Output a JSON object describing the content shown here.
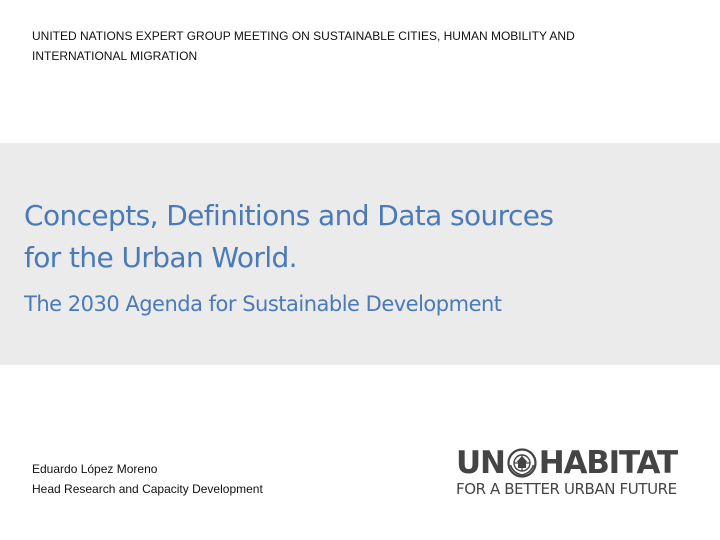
{
  "header": {
    "meeting": "UNITED NATIONS EXPERT GROUP MEETING ON SUSTAINABLE CITIES, HUMAN MOBILITY AND INTERNATIONAL MIGRATION"
  },
  "title": {
    "line1": "Concepts, Definitions and Data sources",
    "line2": "for the Urban World.",
    "subtitle": "The 2030 Agenda for Sustainable Development"
  },
  "author": {
    "name": "Eduardo López Moreno",
    "role": "Head Research and Capacity Development"
  },
  "logo": {
    "left_word": "UN",
    "right_word": "HABITAT",
    "tagline": "FOR A BETTER URBAN FUTURE",
    "emblem_icon": "un-emblem-icon"
  },
  "colors": {
    "title": "#4a7ab8",
    "band": "#ebebeb",
    "logo": "#444444"
  }
}
